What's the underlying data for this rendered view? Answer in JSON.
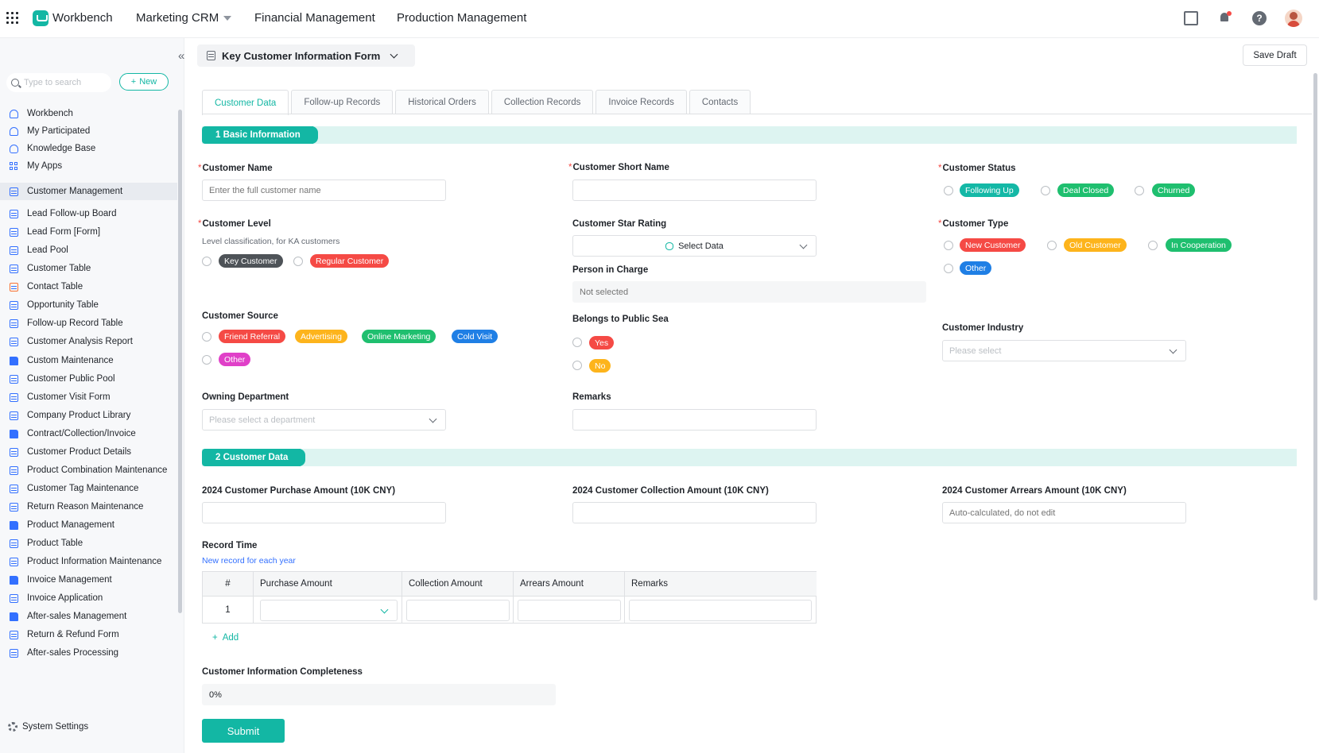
{
  "topbar": {
    "app_name": "Workbench",
    "nav": [
      "Marketing CRM",
      "Financial Management",
      "Production Management"
    ],
    "help_glyph": "?"
  },
  "sidebar": {
    "search_placeholder": "Type to search",
    "new_label": "New",
    "items": [
      {
        "label": "Workbench",
        "icon": "workbench-icon"
      },
      {
        "label": "My Participated",
        "icon": "person-icon"
      },
      {
        "label": "Knowledge Base",
        "icon": "knowledge-icon"
      },
      {
        "label": "My Apps",
        "icon": "apps-icon"
      },
      {
        "label": "Customer Management",
        "icon": "table-icon"
      },
      {
        "label": "Lead Follow-up Board",
        "icon": "table-icon"
      },
      {
        "label": "Lead Form  [Form]",
        "icon": "table-icon"
      },
      {
        "label": "Lead Pool",
        "icon": "table-icon"
      },
      {
        "label": "Customer Table",
        "icon": "table-icon"
      },
      {
        "label": "Contact Table",
        "icon": "report-icon"
      },
      {
        "label": "Opportunity Table",
        "icon": "table-icon"
      },
      {
        "label": "Follow-up Record Table",
        "icon": "table-icon"
      },
      {
        "label": "Customer Analysis Report",
        "icon": "table-icon"
      },
      {
        "label": "Custom Maintenance",
        "icon": "folder-icon"
      },
      {
        "label": "Customer Public Pool",
        "icon": "table-icon"
      },
      {
        "label": "Customer Visit Form",
        "icon": "table-icon"
      },
      {
        "label": "Company Product Library",
        "icon": "table-icon"
      },
      {
        "label": "Contract/Collection/Invoice",
        "icon": "folder-icon"
      },
      {
        "label": "Customer Product Details",
        "icon": "table-icon"
      },
      {
        "label": "Product Combination Maintenance",
        "icon": "table-icon"
      },
      {
        "label": "Customer Tag Maintenance",
        "icon": "table-icon"
      },
      {
        "label": "Return Reason Maintenance",
        "icon": "table-icon"
      },
      {
        "label": "Product Management",
        "icon": "folder-icon"
      },
      {
        "label": "Product Table",
        "icon": "table-icon"
      },
      {
        "label": "Product Information Maintenance",
        "icon": "table-icon"
      },
      {
        "label": "Invoice Management",
        "icon": "folder-icon"
      },
      {
        "label": "Invoice Application",
        "icon": "table-icon"
      },
      {
        "label": "After-sales Management",
        "icon": "folder-icon"
      },
      {
        "label": "Return & Refund Form",
        "icon": "table-icon"
      },
      {
        "label": "After-sales Processing",
        "icon": "table-icon"
      }
    ],
    "system_settings": "System Settings"
  },
  "form": {
    "title": "Key Customer Information Form",
    "save_draft": "Save Draft",
    "tabs": [
      "Customer Data",
      "Follow-up Records",
      "Historical Orders",
      "Collection Records",
      "Invoice Records",
      "Contacts"
    ],
    "section1": "1 Basic Information",
    "section2": "2 Customer Data",
    "required_mark": "*",
    "customer_name": {
      "label": "Customer Name",
      "placeholder": "Enter the full customer name"
    },
    "customer_short_name": {
      "label": "Customer Short Name"
    },
    "customer_status": {
      "label": "Customer Status",
      "options": [
        "Following Up",
        "Deal Closed",
        "Churned"
      ]
    },
    "customer_level": {
      "label": "Customer Level",
      "hint": "Level classification, for KA customers",
      "options": [
        "Key Customer",
        "Regular Customer"
      ]
    },
    "star_rating": {
      "label": "Customer Star Rating",
      "value": "Select Data"
    },
    "person_in_charge": {
      "label": "Person in Charge",
      "placeholder": "Not selected"
    },
    "customer_type": {
      "label": "Customer Type",
      "options": [
        "New Customer",
        "Old Customer",
        "In Cooperation",
        "Other"
      ]
    },
    "customer_source": {
      "label": "Customer Source",
      "options": [
        "Friend Referral",
        "Advertising",
        "Online Marketing",
        "Cold Visit",
        "Other"
      ]
    },
    "public_sea": {
      "label": "Belongs to Public Sea",
      "options": [
        "Yes",
        "No"
      ]
    },
    "industry": {
      "label": "Customer Industry",
      "placeholder": "Please select"
    },
    "department": {
      "label": "Owning Department",
      "placeholder": "Please select a department"
    },
    "remarks": {
      "label": "Remarks"
    },
    "purchase_amount": {
      "label": "2024 Customer Purchase Amount (10K CNY)"
    },
    "collection_amount": {
      "label": "2024 Customer Collection Amount (10K CNY)"
    },
    "arrears_amount": {
      "label": "2024 Customer Arrears Amount (10K CNY)",
      "placeholder": "Auto-calculated, do not edit"
    },
    "record_time": {
      "label": "Record Time",
      "hint": "New record for each year",
      "columns": [
        "#",
        "Purchase Amount",
        "Collection Amount",
        "Arrears Amount",
        "Remarks"
      ],
      "rows": [
        {
          "index": "1"
        }
      ],
      "add_label": "Add"
    },
    "completeness": {
      "label": "Customer Information Completeness",
      "value": "0%"
    },
    "submit": "Submit"
  },
  "colors": {
    "accent": "#13b7a4",
    "required": "#f54a45",
    "link": "#3370ff"
  }
}
